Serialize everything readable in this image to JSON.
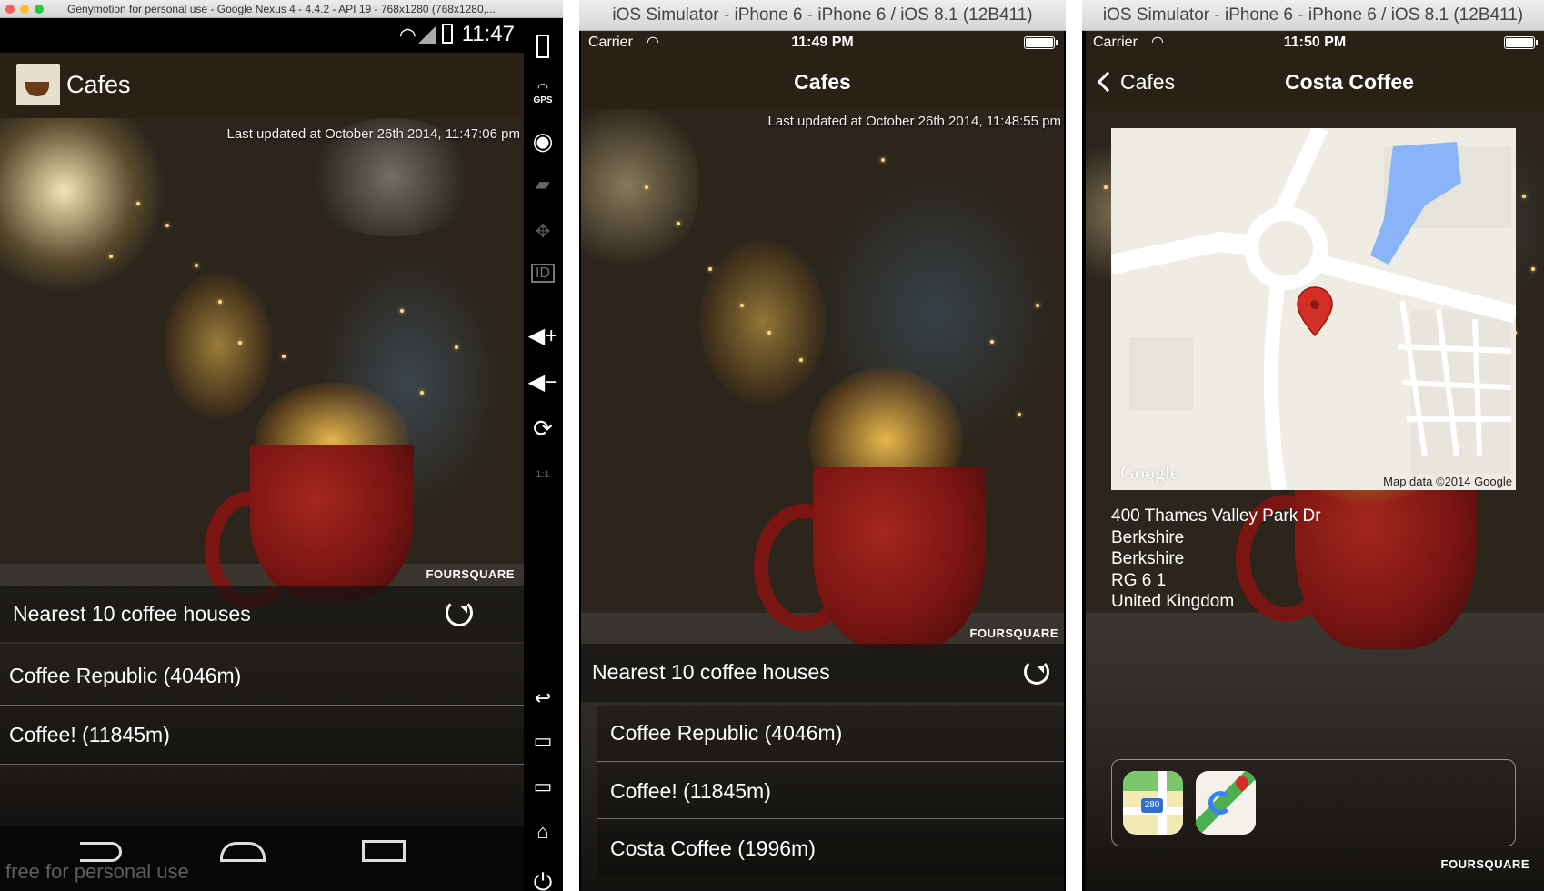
{
  "android": {
    "window_title": "Genymotion for personal use - Google Nexus 4 - 4.4.2 - API 19 - 768x1280 (768x1280,...",
    "clock": "11:47",
    "app_title": "Cafes",
    "last_updated": "Last updated at October 26th 2014, 11:47:06 pm",
    "foursquare": "FOURSQUARE",
    "section_label": "Nearest 10 coffee houses",
    "rows": [
      "Coffee Republic  (4046m)",
      "Coffee!  (11845m)"
    ],
    "watermark": "free for personal use",
    "sidebar": {
      "gps_label": "GPS",
      "id_label": "ID",
      "scale_label": "1:1"
    }
  },
  "ios1": {
    "window_title": "iOS Simulator - iPhone 6 - iPhone 6 / iOS 8.1 (12B411)",
    "carrier": "Carrier",
    "time": "11:49 PM",
    "nav_title": "Cafes",
    "last_updated": "Last updated at October 26th 2014, 11:48:55 pm",
    "foursquare": "FOURSQUARE",
    "section_label": "Nearest 10 coffee houses",
    "rows": [
      "Coffee Republic  (4046m)",
      "Coffee!  (11845m)",
      "Costa Coffee  (1996m)"
    ]
  },
  "ios2": {
    "window_title": "iOS Simulator - iPhone 6 - iPhone 6 / iOS 8.1 (12B411)",
    "carrier": "Carrier",
    "time": "11:50 PM",
    "back_label": "Cafes",
    "nav_title": "Costa Coffee",
    "map_logo": "Google",
    "map_credit": "Map data ©2014 Google",
    "map_badge": "280",
    "address": [
      "400 Thames Valley Park Dr",
      "Berkshire",
      "Berkshire",
      "RG 6 1",
      "United Kingdom"
    ],
    "foursquare": "FOURSQUARE"
  },
  "colors": {
    "actionbar": "#2a2015",
    "pin": "#d42f26",
    "water": "#8ab4f8",
    "maps_green": "#4caf50"
  }
}
